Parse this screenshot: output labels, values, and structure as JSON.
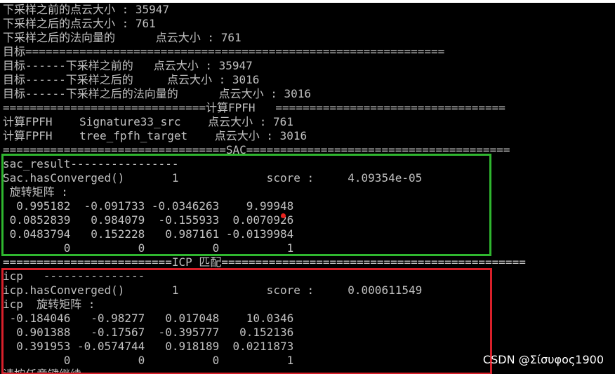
{
  "console": {
    "lines": [
      "下采样之前的点云大小 : 35947",
      "下采样之后的点云大小 : 761",
      "下采样之后的法向量的      点云大小 : 761",
      "目标==============================================================",
      "目标------下采样之前的   点云大小 : 35947",
      "目标------下采样之后的     点云大小 : 3016",
      "目标------下采样之后的法向量的      点云大小 : 3016",
      "==============================计算FPFH   ==================================",
      "计算FPFH    Signature33_src    点云大小 : 761",
      "计算FPFH    tree_fpfh_target    点云大小 : 3016",
      "=================================SAC=======================================",
      "sac_result----------------",
      "Sac.hasConverged()       1             score :     4.09354e-05",
      " 旋转矩阵 :",
      "  0.995182  -0.091733 -0.0346263    9.99948",
      " 0.0852839   0.984079  -0.155933  0.0070926",
      " 0.0483794   0.152228   0.987161 -0.0139984",
      "         0          0          0          1",
      "=========================ICP 匹配=============================================",
      "icp   ---------------",
      "icp.hasConverged()       1             score :     0.000611549",
      "icp  旋转矩阵 :",
      " -0.184046   -0.98277   0.017048    10.0346",
      "  0.901388   -0.17567  -0.395777   0.152136",
      "  0.391953 -0.0574744   0.918189  0.0211873",
      "         0          0          0          1",
      "请按任意键继续. . ."
    ]
  },
  "watermark": "CSDN @Σίσυφος1900",
  "colors": {
    "console_bg": "#000000",
    "console_text": "#c0c0c0",
    "green_box": "#2fb62f",
    "red_box": "#d8202a"
  }
}
